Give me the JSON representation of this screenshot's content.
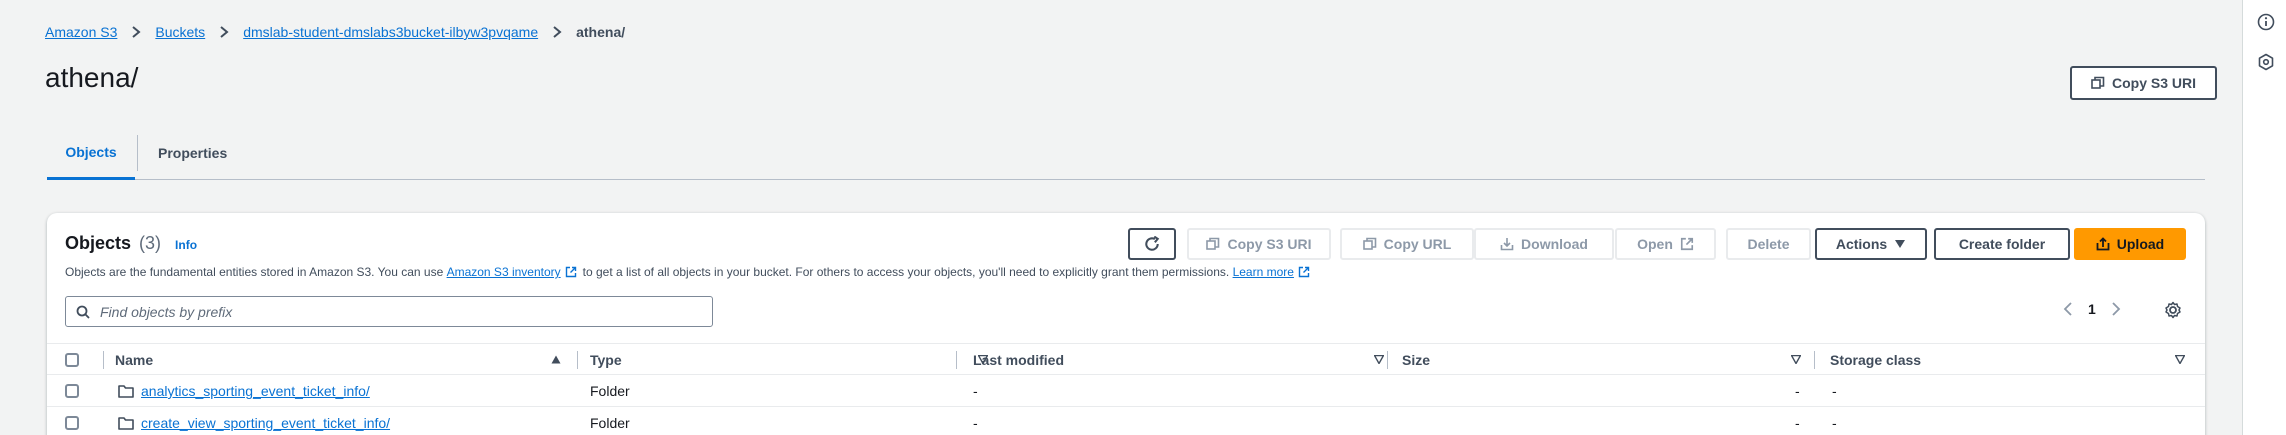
{
  "breadcrumb": {
    "items": [
      "Amazon S3",
      "Buckets",
      "dmslab-student-dmslabs3bucket-ilbyw3pvqame"
    ],
    "current": "athena/"
  },
  "page": {
    "title": "athena/",
    "copy_uri_label": "Copy S3 URI"
  },
  "tabs": [
    {
      "label": "Objects",
      "active": true
    },
    {
      "label": "Properties",
      "active": false
    }
  ],
  "objects_panel": {
    "title": "Objects",
    "count": "(3)",
    "info_label": "Info",
    "description": {
      "part1": "Objects are the fundamental entities stored in Amazon S3. You can use ",
      "link1": "Amazon S3 inventory",
      "part2": "to get a list of all objects in your bucket. For others to access your objects, you'll need to explicitly grant them permissions. ",
      "link2": "Learn more"
    },
    "toolbar": {
      "copy_s3_uri": "Copy S3 URI",
      "copy_url": "Copy URL",
      "download": "Download",
      "open": "Open",
      "delete": "Delete",
      "actions": "Actions",
      "create_folder": "Create folder",
      "upload": "Upload"
    },
    "search": {
      "placeholder": "Find objects by prefix",
      "value": ""
    },
    "pagination": {
      "current_page": "1"
    },
    "columns": [
      "Name",
      "Type",
      "Last modified",
      "Size",
      "Storage class"
    ],
    "rows": [
      {
        "name": "analytics_sporting_event_ticket_info/",
        "type": "Folder",
        "last_modified": "-",
        "size": "-",
        "storage_class": "-"
      },
      {
        "name": "create_view_sporting_event_ticket_info/",
        "type": "Folder",
        "last_modified": "-",
        "size": "-",
        "storage_class": "-"
      }
    ]
  },
  "colors": {
    "link": "#0972d3",
    "primary": "#ff9900",
    "text": "#16191f",
    "background": "#f2f3f3"
  }
}
